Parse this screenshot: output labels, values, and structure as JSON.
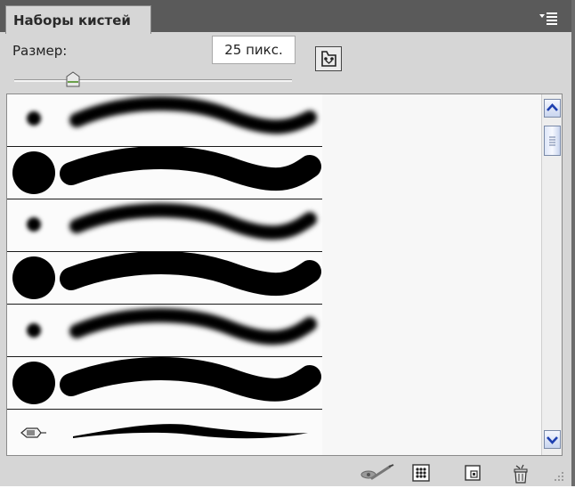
{
  "panel": {
    "tab_title": "Наборы кистей",
    "menu_icon": "panel-menu-icon"
  },
  "size": {
    "label": "Размер:",
    "value": "25 пикс.",
    "slider_fraction": 0.2
  },
  "folder_button_icon": "folder-brush-icon",
  "brushes": [
    {
      "kind": "soft",
      "stroke": "soft-wave"
    },
    {
      "kind": "hard",
      "stroke": "hard-wave"
    },
    {
      "kind": "soft",
      "stroke": "soft-wave"
    },
    {
      "kind": "hard",
      "stroke": "hard-wave"
    },
    {
      "kind": "soft",
      "stroke": "soft-wave"
    },
    {
      "kind": "hard",
      "stroke": "hard-wave"
    },
    {
      "kind": "brush-tip",
      "stroke": "tapered-stroke"
    }
  ],
  "bottom_icons": [
    "brush-options-icon",
    "brush-grid-icon",
    "new-preset-icon",
    "delete-icon"
  ],
  "colors": {
    "tab_bar": "#5a5a5a",
    "panel": "#d6d6d6",
    "list_bg": "#f7f7f7",
    "scroll_accent": "#1d3fb0"
  }
}
